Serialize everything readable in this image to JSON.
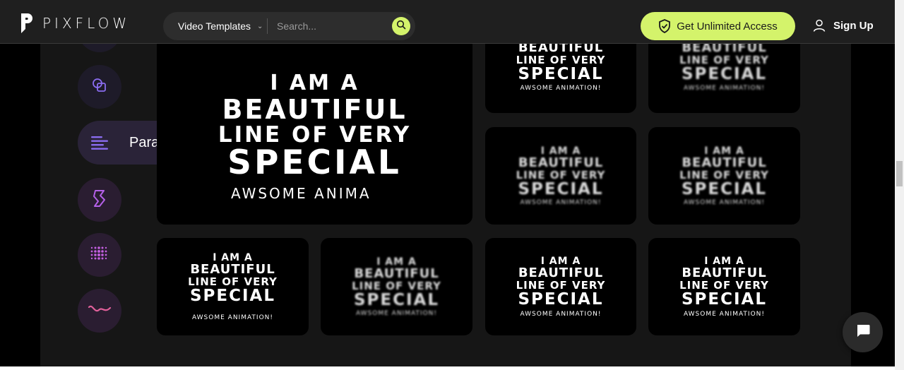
{
  "header": {
    "logo_text": "PIXFLOW",
    "category_label": "Video Templates",
    "search_placeholder": "Search...",
    "cta_label": "Get Unlimited Access",
    "signup_label": "Sign Up"
  },
  "rail": {
    "active_item_label": "Paragraph"
  },
  "card_text": {
    "line1": "I AM A",
    "line2": "BEAUTIFUL",
    "line3": "LINE OF VERY",
    "line4": "SPECIAL",
    "sub": "AWSOME ANIMATION!",
    "sub_partial": "AWSOME ANIMA"
  },
  "colors": {
    "accent": "#d4f36b",
    "header_bg": "#1f1f1f",
    "panel_bg": "#161616",
    "rail_btn_bg": "#1e1b29",
    "icon_purple": "#8a6cf0",
    "icon_pink": "#c35fe0"
  },
  "icons": {
    "search": "search-icon",
    "shield": "shield-check-icon",
    "user": "user-icon",
    "chat": "chat-icon"
  }
}
